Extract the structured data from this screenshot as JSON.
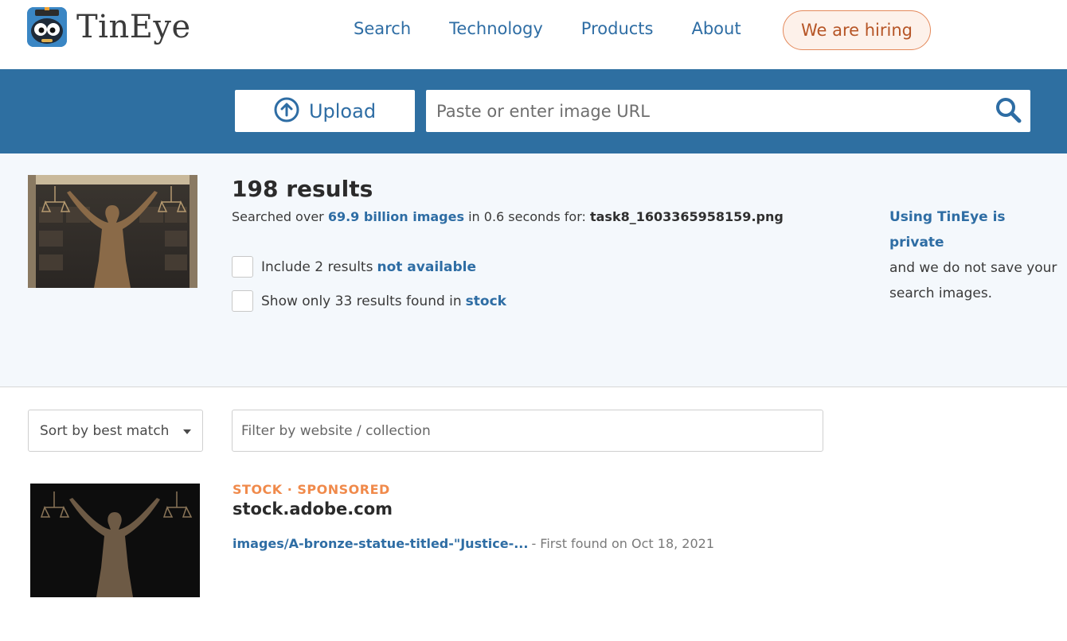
{
  "header": {
    "brand": "TinEye",
    "logo_icon": "tineye-robot-logo",
    "nav": [
      {
        "label": "Search"
      },
      {
        "label": "Technology"
      },
      {
        "label": "Products"
      },
      {
        "label": "About"
      }
    ],
    "hiring_label": "We are hiring"
  },
  "searchbar": {
    "upload_label": "Upload",
    "upload_icon": "upload-arrow-icon",
    "url_placeholder": "Paste or enter image URL",
    "search_icon": "search-icon"
  },
  "summary": {
    "results_count": "198 results",
    "searched_prefix": "Searched over ",
    "searched_link": "69.9 billion images",
    "searched_mid": " in 0.6 seconds for: ",
    "filename": "task8_1603365958159.png",
    "include_text": "Include 2 results",
    "include_link": "not available",
    "stock_text": "Show only 33 results found in",
    "stock_link": "stock",
    "privacy_link": "Using TinEye is private",
    "privacy_text": "and we do not save your search images."
  },
  "filters": {
    "sort_label": "Sort by best match",
    "filter_placeholder": "Filter by website / collection"
  },
  "results": [
    {
      "tags": "STOCK · SPONSORED",
      "domain": "stock.adobe.com",
      "link": "images/A-bronze-statue-titled-\"Justice-...",
      "found": "- First found on Oct 18, 2021"
    }
  ],
  "colors": {
    "brand_blue": "#2e6fa1",
    "link_blue": "#2e6da4",
    "hiring_orange": "#b65526",
    "stock_orange": "#f08a4b"
  }
}
